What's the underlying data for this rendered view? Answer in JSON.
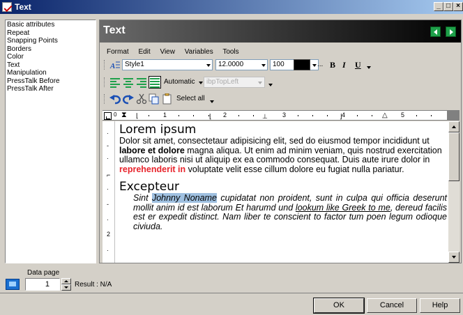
{
  "window": {
    "title": "Text",
    "min_label": "_",
    "max_label": "□",
    "close_label": "×"
  },
  "sidebar": {
    "items": [
      {
        "label": "Basic attributes"
      },
      {
        "label": "Repeat"
      },
      {
        "label": "Snapping Points"
      },
      {
        "label": "Borders"
      },
      {
        "label": "Color"
      },
      {
        "label": "Text",
        "selected": true
      },
      {
        "label": "Manipulation"
      },
      {
        "label": "PressTalk Before"
      },
      {
        "label": "PressTalk After"
      }
    ]
  },
  "editor": {
    "header_title": "Text",
    "menu": [
      "Format",
      "Edit",
      "View",
      "Variables",
      "Tools"
    ],
    "toolbar1": {
      "style": "Style1",
      "font_size": "12.0000",
      "zoom": "100",
      "color": "#000000",
      "more": "...",
      "bold": "B",
      "italic": "I",
      "underline": "U"
    },
    "toolbar2": {
      "line_spacing": "Automatic",
      "anchor": "ibpTopLeft"
    },
    "toolbar3": {
      "select_all": "Select all"
    },
    "ruler_numbers": [
      "1",
      "2",
      "3",
      "4",
      "5"
    ],
    "vruler_numbers": [
      "1",
      "2"
    ],
    "doc": {
      "h1": "Lorem ipsum",
      "p1_a": "Dolor sit amet, consectetaur adipisicing elit, sed do eiusmod tempor incididunt ut ",
      "p1_bold": "labore et dolore",
      "p1_b": " magna aliqua. Ut enim ad minim veniam, quis nostrud exercitation ullamco laboris nisi ut aliquip ex ea commodo consequat. Duis aute irure dolor in ",
      "p1_red": "reprehenderit in",
      "p1_c": " voluptate velit esse cillum dolore eu fugiat nulla pariatur.",
      "h2": "Excepteur",
      "p2_a": "Sint ",
      "p2_hl": "Johnny Noname",
      "p2_b": " cupidatat non proident, sunt in culpa qui officia deserunt mollit anim id est laborum Et harumd und ",
      "p2_ul": "lookum like Greek to me",
      "p2_c": ", dereud facilis est er expedit distinct. Nam liber te conscient to factor tum poen legum odioque civiuda."
    }
  },
  "bottom": {
    "data_page_label": "Data page",
    "data_page_value": "1",
    "result": "Result : N/A",
    "ok": "OK",
    "cancel": "Cancel",
    "help": "Help"
  },
  "colors": {
    "red_text": "#e8242c",
    "highlight": "#9fc0e0",
    "nav_green": "#1ea04a",
    "title_blue": "#0a246a"
  }
}
